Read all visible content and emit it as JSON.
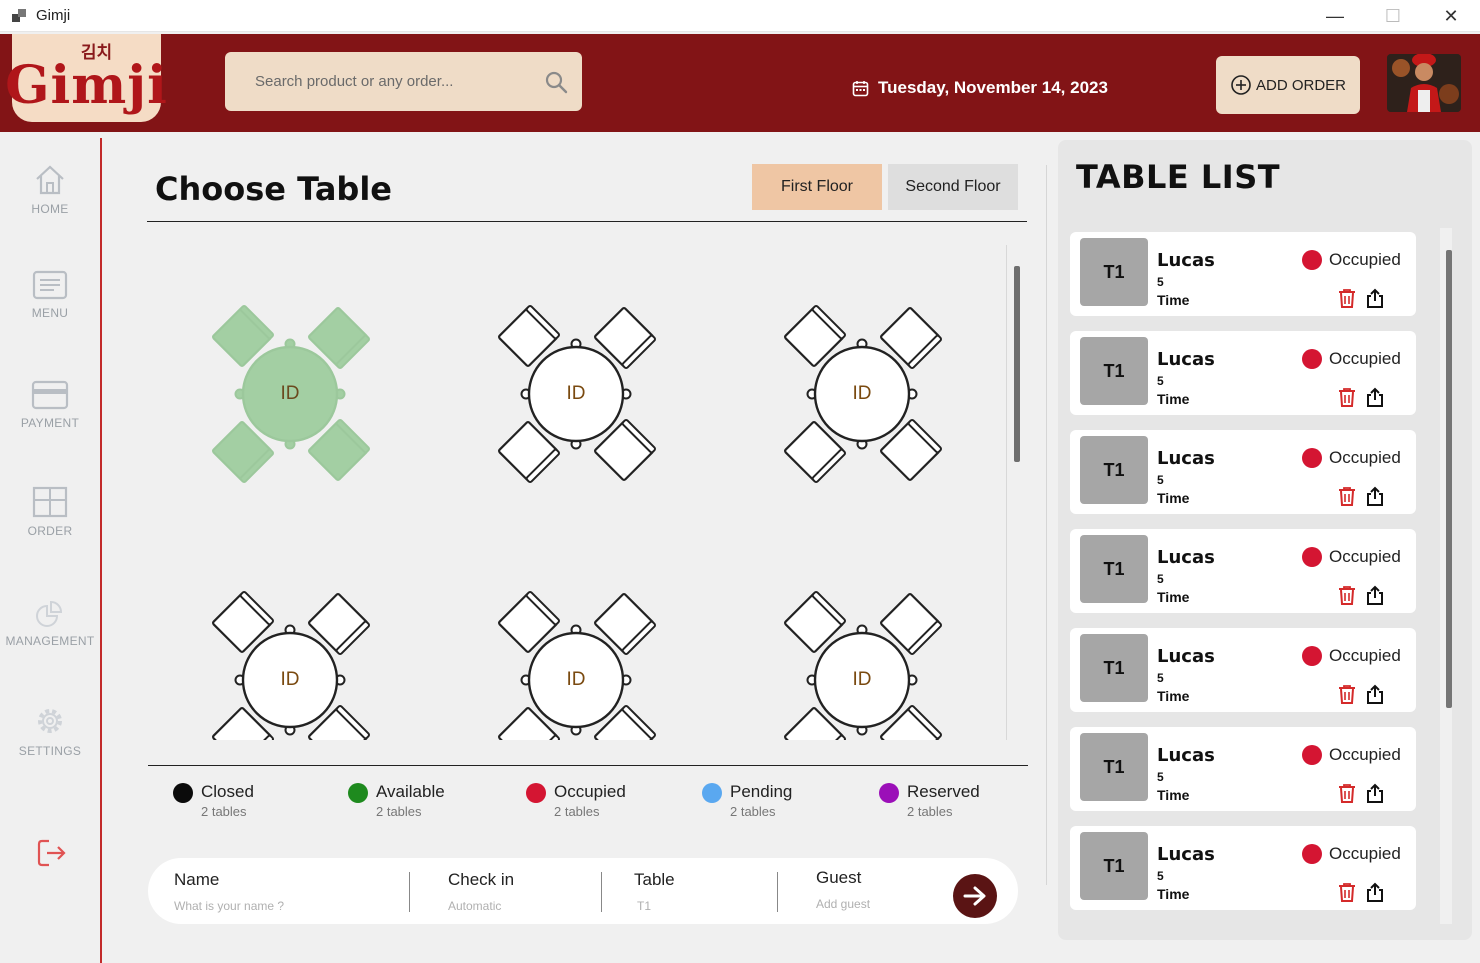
{
  "window": {
    "title": "Gimji"
  },
  "header": {
    "logo_korean": "김치",
    "logo_text": "Gimji",
    "search_placeholder": "Search product or any order...",
    "date": "Tuesday, November 14, 2023",
    "add_order_label": "ADD ORDER"
  },
  "sidebar": {
    "items": [
      {
        "label": "HOME",
        "icon": "home-icon"
      },
      {
        "label": "MENU",
        "icon": "menu-icon"
      },
      {
        "label": "PAYMENT",
        "icon": "payment-icon"
      },
      {
        "label": "ORDER",
        "icon": "order-icon"
      },
      {
        "label": "MANAGEMENT",
        "icon": "management-icon"
      },
      {
        "label": "SETTINGS",
        "icon": "settings-icon"
      }
    ],
    "logout_icon": "logout-icon"
  },
  "main": {
    "title": "Choose Table",
    "floors": [
      "First Floor",
      "Second Floor"
    ],
    "active_floor": "First Floor",
    "tables": [
      {
        "id": "ID",
        "status": "available"
      },
      {
        "id": "ID",
        "status": "default"
      },
      {
        "id": "ID",
        "status": "default"
      },
      {
        "id": "ID",
        "status": "default"
      },
      {
        "id": "ID",
        "status": "default"
      },
      {
        "id": "ID",
        "status": "default"
      }
    ],
    "legend": [
      {
        "name": "Closed",
        "count": "2 tables",
        "color": "#0b0b0b"
      },
      {
        "name": "Available",
        "count": "2 tables",
        "color": "#1e8a1e"
      },
      {
        "name": "Occupied",
        "count": "2 tables",
        "color": "#d41532"
      },
      {
        "name": "Pending",
        "count": "2 tables",
        "color": "#5aa8f0"
      },
      {
        "name": "Reserved",
        "count": "2 tables",
        "color": "#9b0fb8"
      }
    ],
    "booking": {
      "name_label": "Name",
      "name_placeholder": "What is your name ?",
      "checkin_label": "Check in",
      "checkin_value": "Automatic",
      "table_label": "Table",
      "table_value": "T1",
      "guest_label": "Guest",
      "guest_placeholder": "Add guest"
    }
  },
  "table_list": {
    "title": "TABLE LIST",
    "cards": [
      {
        "table": "T1",
        "name": "Lucas",
        "guests": "5",
        "time": "Time",
        "status": "Occupied"
      },
      {
        "table": "T1",
        "name": "Lucas",
        "guests": "5",
        "time": "Time",
        "status": "Occupied"
      },
      {
        "table": "T1",
        "name": "Lucas",
        "guests": "5",
        "time": "Time",
        "status": "Occupied"
      },
      {
        "table": "T1",
        "name": "Lucas",
        "guests": "5",
        "time": "Time",
        "status": "Occupied"
      },
      {
        "table": "T1",
        "name": "Lucas",
        "guests": "5",
        "time": "Time",
        "status": "Occupied"
      },
      {
        "table": "T1",
        "name": "Lucas",
        "guests": "5",
        "time": "Time",
        "status": "Occupied"
      },
      {
        "table": "T1",
        "name": "Lucas",
        "guests": "5",
        "time": "Time",
        "status": "Occupied"
      }
    ]
  },
  "colors": {
    "brand": "#821416",
    "cream": "#efdcc7",
    "occupied": "#d41532",
    "available_table": "#a3cfa3"
  }
}
